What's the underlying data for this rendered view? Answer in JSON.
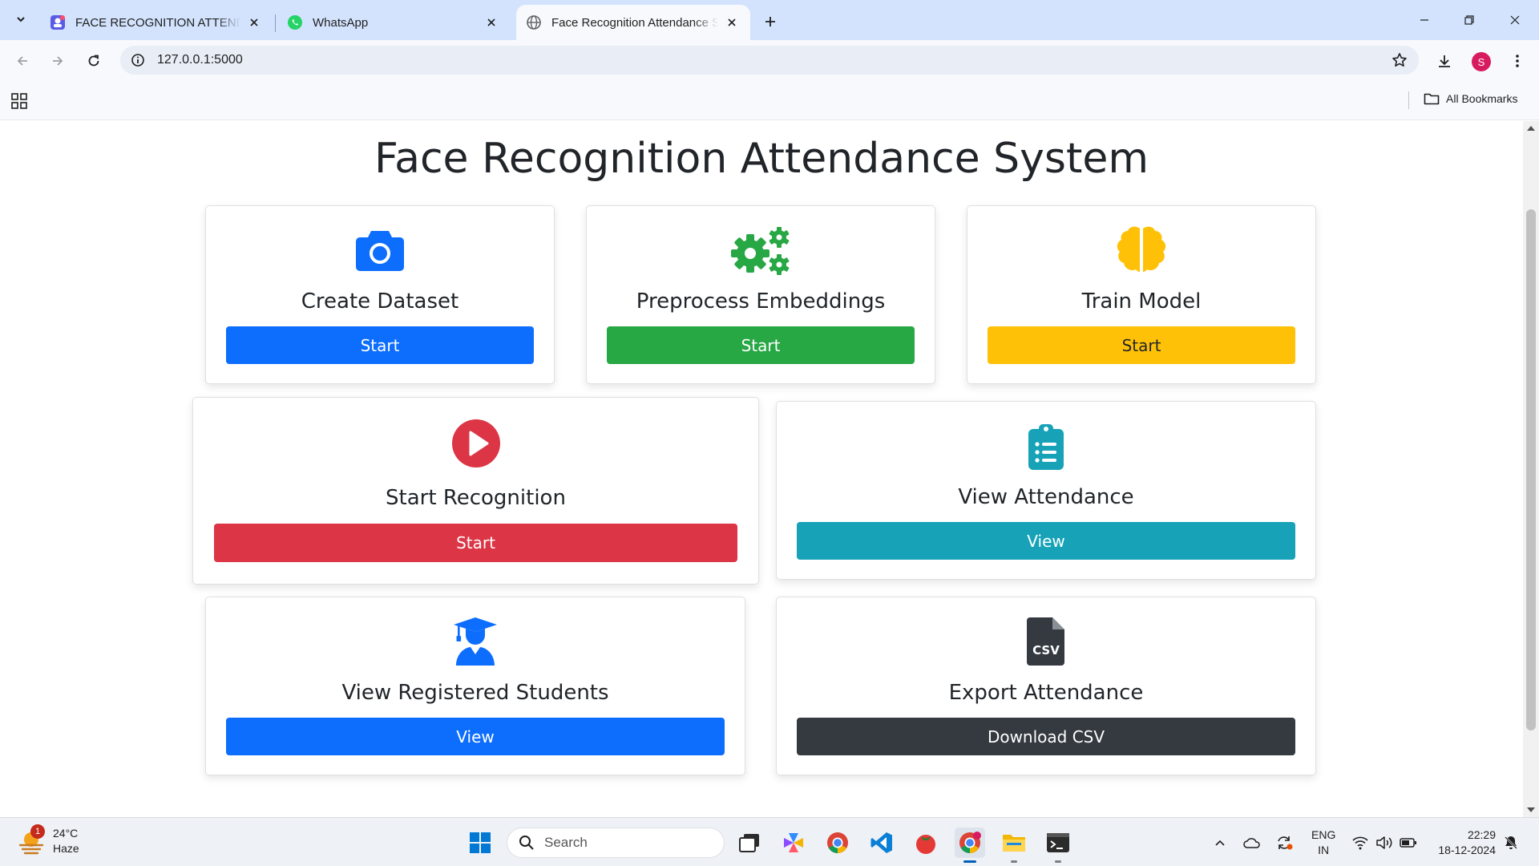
{
  "browser": {
    "tabs": [
      {
        "title": "FACE RECOGNITION ATTENDANCE",
        "favicon": "app-icon"
      },
      {
        "title": "WhatsApp",
        "favicon": "whatsapp-icon"
      },
      {
        "title": "Face Recognition Attendance System",
        "favicon": "globe-icon",
        "active": true
      }
    ],
    "url": "127.0.0.1:5000",
    "profile_initial": "S",
    "all_bookmarks_label": "All Bookmarks"
  },
  "page": {
    "title": "Face Recognition Attendance System",
    "cards": [
      {
        "title": "Create Dataset",
        "button": "Start",
        "icon": "camera-icon",
        "color": "#0d6efd"
      },
      {
        "title": "Preprocess Embeddings",
        "button": "Start",
        "icon": "gears-icon",
        "color": "#28a745"
      },
      {
        "title": "Train Model",
        "button": "Start",
        "icon": "brain-icon",
        "color": "#ffc107"
      },
      {
        "title": "Start Recognition",
        "button": "Start",
        "icon": "play-circle-icon",
        "color": "#dc3545"
      },
      {
        "title": "View Attendance",
        "button": "View",
        "icon": "clipboard-list-icon",
        "color": "#17a2b8"
      },
      {
        "title": "View Registered Students",
        "button": "View",
        "icon": "graduate-icon",
        "color": "#0d6efd"
      },
      {
        "title": "Export Attendance",
        "button": "Download CSV",
        "icon": "csv-file-icon",
        "color": "#343a40"
      }
    ]
  },
  "taskbar": {
    "weather": {
      "temp": "24°C",
      "condition": "Haze",
      "badge": "1"
    },
    "search_placeholder": "Search",
    "language": {
      "line1": "ENG",
      "line2": "IN"
    },
    "clock": {
      "time": "22:29",
      "date": "18-12-2024"
    }
  }
}
